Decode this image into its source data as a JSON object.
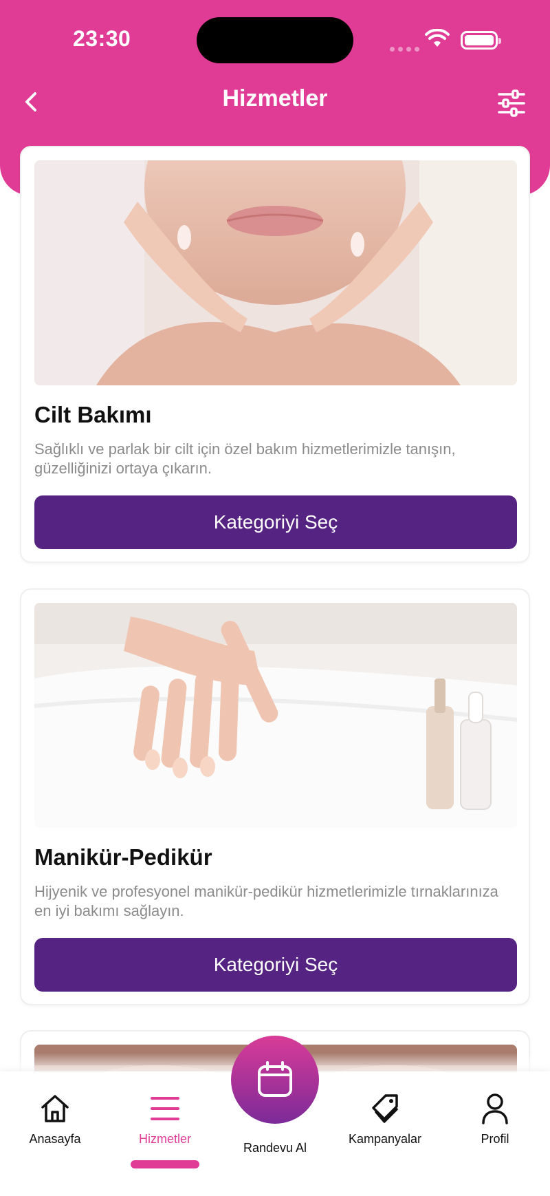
{
  "status_bar": {
    "time": "23:30"
  },
  "header": {
    "title": "Hizmetler"
  },
  "cards": [
    {
      "title": "Cilt Bakımı",
      "description": "Sağlıklı ve parlak bir cilt için özel bakım hizmetlerimizle tanışın, güzelliğinizi ortaya çıkarın.",
      "button_label": "Kategoriyi Seç"
    },
    {
      "title": "Manikür-Pedikür",
      "description": "Hijyenik ve profesyonel manikür-pedikür hizmetlerimizle tırnaklarınıza en iyi bakımı sağlayın.",
      "button_label": "Kategoriyi Seç"
    }
  ],
  "bottom_nav": {
    "items": [
      {
        "label": "Anasayfa",
        "icon": "home-icon"
      },
      {
        "label": "Hizmetler",
        "icon": "menu-icon"
      },
      {
        "label": "Randevu Al",
        "icon": "calendar-icon"
      },
      {
        "label": "Kampanyalar",
        "icon": "tag-icon"
      },
      {
        "label": "Profil",
        "icon": "user-icon"
      }
    ],
    "active_index": 1
  },
  "colors": {
    "primary_pink": "#e03c96",
    "button_purple": "#552381",
    "text_muted": "#8b8b8b"
  }
}
